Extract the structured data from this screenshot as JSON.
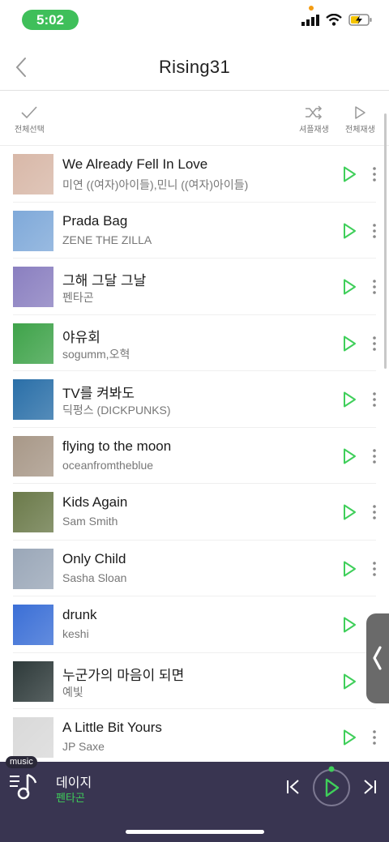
{
  "status_bar": {
    "time": "5:02"
  },
  "header": {
    "title": "Rising31"
  },
  "toolbar": {
    "select_all": "전체선택",
    "shuffle_play": "셔플재생",
    "play_all": "전체재생"
  },
  "songs": [
    {
      "title": "We Already Fell In Love",
      "artist": "미연 ((여자)아이들),민니 ((여자)아이들)",
      "art_color": "#d8b8a8"
    },
    {
      "title": "Prada Bag",
      "artist": "ZENE THE ZILLA",
      "art_color": "#7fa9d9"
    },
    {
      "title": "그해 그달 그날",
      "artist": "펜타곤",
      "art_color": "#8a7fc0"
    },
    {
      "title": "야유회",
      "artist": "sogumm,오혁",
      "art_color": "#3fa34a"
    },
    {
      "title": "TV를 켜봐도",
      "artist": "딕펑스 (DICKPUNKS)",
      "art_color": "#2a6fa8"
    },
    {
      "title": "flying to the moon",
      "artist": "oceanfromtheblue",
      "art_color": "#a89888"
    },
    {
      "title": "Kids Again",
      "artist": "Sam Smith",
      "art_color": "#6b7a4a"
    },
    {
      "title": "Only Child",
      "artist": "Sasha Sloan",
      "art_color": "#9aa7b8"
    },
    {
      "title": "drunk",
      "artist": "keshi",
      "art_color": "#3b6fd6"
    },
    {
      "title": "누군가의 마음이 되면",
      "artist": "예빛",
      "art_color": "#2e3a3a"
    },
    {
      "title": "A Little Bit Yours",
      "artist": "JP Saxe",
      "art_color": "#d9d9d9"
    }
  ],
  "mini_player": {
    "badge": "music",
    "now_title": "데이지",
    "now_artist": "펜타곤"
  },
  "colors": {
    "accent_green": "#3fcf5a",
    "player_bg": "#393551"
  }
}
